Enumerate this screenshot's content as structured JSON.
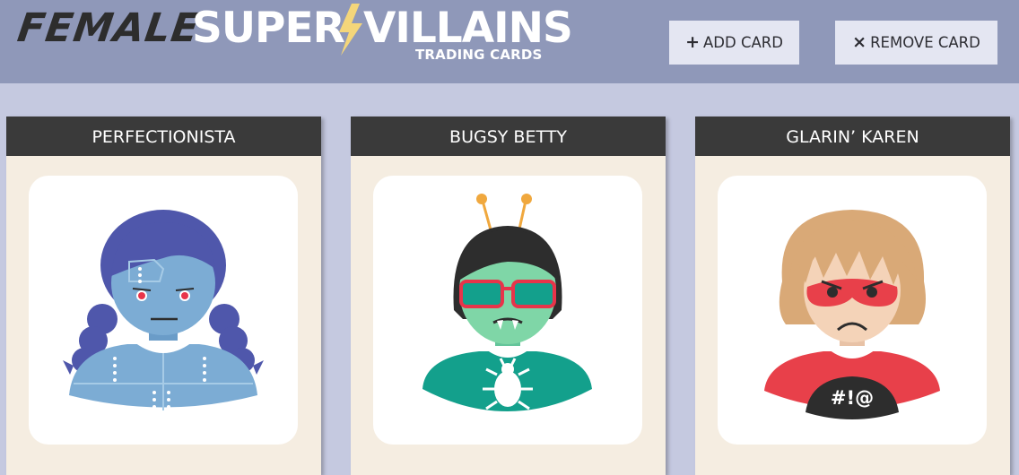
{
  "header": {
    "logo_female": "FEMALE",
    "logo_super": "SUPER",
    "logo_villains": "VILLAINS",
    "logo_subtitle": "TRADING CARDS",
    "add_button": {
      "icon": "+",
      "label": "ADD CARD"
    },
    "remove_button": {
      "icon": "×",
      "label": "REMOVE CARD"
    }
  },
  "cards": [
    {
      "name": "PERFECTIONISTA"
    },
    {
      "name": "BUGSY BETTY"
    },
    {
      "name": "GLARIN’ KAREN",
      "shirt_text": "#!@"
    }
  ],
  "colors": {
    "header_bg": "#8f98b9",
    "page_bg": "#c5c9e0",
    "card_bg": "#f5ede1",
    "card_title_bg": "#3a3a3a",
    "button_bg": "#e4e6f2",
    "bolt": "#f4d67a"
  }
}
